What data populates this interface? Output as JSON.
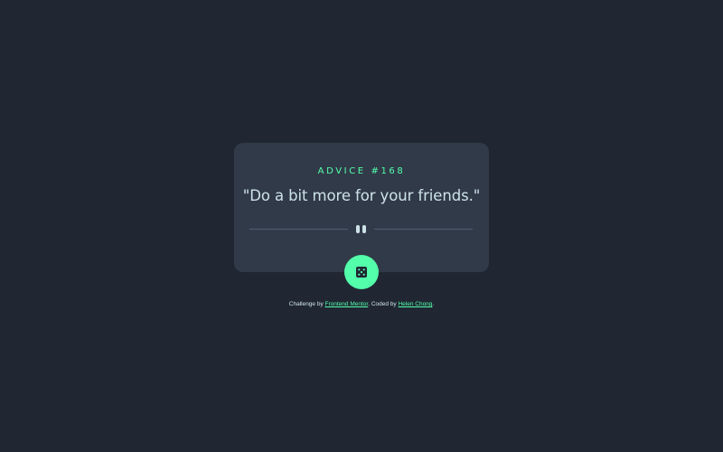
{
  "card": {
    "advice_label": "ADVICE #168",
    "quote": "\"Do a bit more for your friends.\""
  },
  "dice_button": {
    "icon": "dice-icon"
  },
  "attribution": {
    "prefix": "Challenge by ",
    "challenge_link": "Frontend Mentor",
    "middle": ". Coded by ",
    "author_link": "Helen Chong",
    "suffix": "."
  },
  "colors": {
    "background": "#202733",
    "card": "#313a48",
    "accent": "#53ffaa",
    "text": "#cee3e9",
    "divider": "#4f5d74"
  }
}
